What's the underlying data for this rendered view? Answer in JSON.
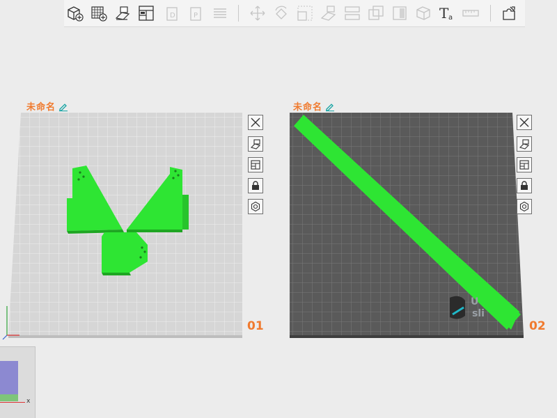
{
  "toolbar": {
    "tools": [
      {
        "name": "add-model-icon"
      },
      {
        "name": "add-plate-icon"
      },
      {
        "name": "import-layout-icon"
      },
      {
        "name": "arrange-icon"
      },
      {
        "name": "copy-icon"
      },
      {
        "name": "paste-icon"
      },
      {
        "name": "list-icon"
      },
      {
        "name": "move-icon"
      },
      {
        "name": "rotate-icon"
      },
      {
        "name": "scale-icon"
      },
      {
        "name": "lay-flat-icon"
      },
      {
        "name": "cut-icon"
      },
      {
        "name": "hollow-icon"
      },
      {
        "name": "support-icon"
      },
      {
        "name": "view-cube-icon"
      },
      {
        "name": "text-icon"
      },
      {
        "name": "measure-icon"
      },
      {
        "name": "puzzle-icon"
      }
    ]
  },
  "plates": [
    {
      "label": "未命名",
      "number": "01"
    },
    {
      "label": "未命名",
      "number": "02"
    }
  ],
  "watermark": {
    "text_line1": "U",
    "text_line2": "sli"
  },
  "mini_preview": {
    "axis_label": "x"
  },
  "colors": {
    "accent": "#f07a2e",
    "model_green": "#2ee533",
    "plate_light": "#d8d8d8",
    "plate_dark": "#5a5a5a"
  }
}
